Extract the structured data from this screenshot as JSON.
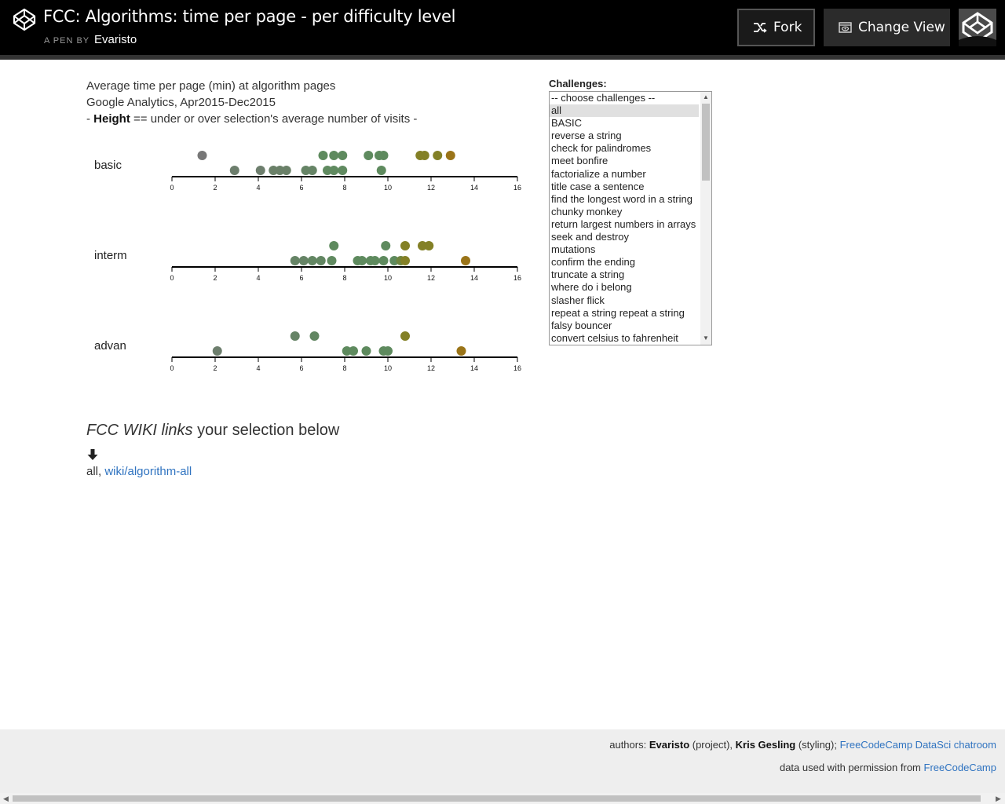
{
  "header": {
    "title": "FCC: Algorithms: time per page - per difficulty level",
    "byline_prefix": "A PEN BY",
    "author": "Evaristo",
    "fork_label": "Fork",
    "change_view_label": "Change View"
  },
  "description": {
    "line1": "Average time per page (min) at algorithm pages",
    "line2": "Google Analytics, Apr2015-Dec2015",
    "line3_prefix": "- ",
    "line3_bold": "Height",
    "line3_rest": " == under or over selection's average number of visits -"
  },
  "chart_data": {
    "type": "scatter",
    "title": "",
    "xlabel": "",
    "ylabel": "",
    "xlim": [
      0,
      16
    ],
    "xticks": [
      0,
      2,
      4,
      6,
      8,
      10,
      12,
      14,
      16
    ],
    "rows": [
      {
        "name": "basic",
        "over": [
          1.4,
          7.0,
          7.5,
          7.9,
          9.1,
          9.6,
          9.8,
          11.5,
          11.7,
          12.3,
          12.9
        ],
        "under": [
          2.9,
          4.1,
          4.7,
          5.0,
          5.3,
          6.2,
          6.5,
          7.2,
          7.5,
          7.9,
          9.7
        ],
        "over_colors": [
          "#777777",
          "#5e8a5e",
          "#5e8a5e",
          "#5e8a5e",
          "#5e8a5e",
          "#5e8a5e",
          "#5e8a5e",
          "#838026",
          "#838026",
          "#838026",
          "#9a7418"
        ],
        "under_colors": [
          "#6d7e6d",
          "#6d7e6d",
          "#6a8068",
          "#6a8068",
          "#6a8068",
          "#668466",
          "#668466",
          "#608a60",
          "#608a60",
          "#608a60",
          "#5e8a5e"
        ]
      },
      {
        "name": "interm",
        "over": [
          7.5,
          9.9,
          10.8,
          11.6,
          11.9
        ],
        "under": [
          5.7,
          6.1,
          6.5,
          6.9,
          7.4,
          8.6,
          8.8,
          9.2,
          9.4,
          9.8,
          10.3,
          10.6,
          10.8,
          13.6
        ],
        "over_colors": [
          "#5e8a5e",
          "#5e8a5e",
          "#838026",
          "#838026",
          "#838026"
        ],
        "under_colors": [
          "#668466",
          "#668466",
          "#628662",
          "#628662",
          "#608a60",
          "#5e8a5e",
          "#5e8a5e",
          "#5e8a5e",
          "#5e8a5e",
          "#5e8a5e",
          "#5e8a5e",
          "#6e8540",
          "#838026",
          "#9a7418"
        ]
      },
      {
        "name": "advan",
        "over": [
          5.7,
          6.6,
          10.8
        ],
        "under": [
          2.1,
          8.1,
          8.4,
          9.0,
          9.8,
          10.0,
          13.4
        ],
        "over_colors": [
          "#668466",
          "#628662",
          "#838026"
        ],
        "under_colors": [
          "#6d7e6d",
          "#5e8a5e",
          "#5e8a5e",
          "#5e8a5e",
          "#5e8a5e",
          "#5e8a5e",
          "#9a7418"
        ]
      }
    ]
  },
  "challenges": {
    "label": "Challenges:",
    "selected_index": 1,
    "options": [
      "-- choose challenges --",
      "all",
      "BASIC",
      "reverse a string",
      "check for palindromes",
      "meet bonfire",
      "factorialize a number",
      "title case a sentence",
      "find the longest word in a string",
      "chunky monkey",
      "return largest numbers in arrays",
      "seek and destroy",
      "mutations",
      "confirm the ending",
      "truncate a string",
      "where do i belong",
      "slasher flick",
      "repeat a string repeat a string",
      "falsy bouncer",
      "convert celsius to fahrenheit"
    ]
  },
  "wiki": {
    "heading_italic": "FCC WIKI links",
    "heading_rest": " your selection below",
    "selection_text": "all, ",
    "link_text": "wiki/algorithm-all"
  },
  "footer": {
    "authors_prefix": "authors: ",
    "author1": "Evaristo",
    "author1_role": " (project), ",
    "author2": "Kris Gesling",
    "author2_role": " (styling); ",
    "chatroom_link": "FreeCodeCamp DataSci chatroom",
    "data_prefix": "data used with permission from ",
    "data_link": "FreeCodeCamp"
  },
  "colors": {
    "header_bg": "#000000",
    "link": "#2f73c0",
    "footer_bg": "#eeeeee"
  }
}
